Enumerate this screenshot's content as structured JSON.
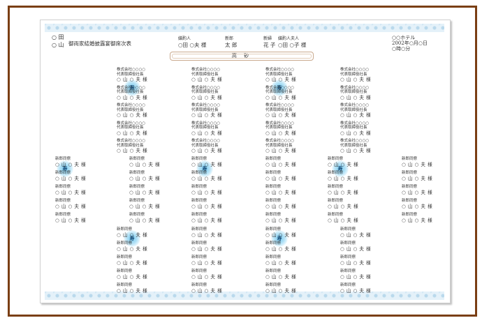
{
  "header": {
    "left_lines": [
      "○ 田",
      "○ 山"
    ],
    "title": "御両家結婚披露宴御席次表",
    "columns": [
      {
        "label": "媒酌人",
        "value": "○田 ○夫 様"
      },
      {
        "label": "新郎",
        "value": "太 郎"
      },
      {
        "label": "新婦",
        "value": "花 子"
      },
      {
        "label": "媒酌人夫人",
        "value": "○田 ○子 様"
      }
    ],
    "hotel": "○○ホテル",
    "date": "2002年○月○日",
    "time": "○時○分"
  },
  "head_table_label": "高 砂",
  "table_label": "寿",
  "guests": {
    "company_line1": "株式会社○○○○",
    "company_line2": "代表取締役社長",
    "colleague_line1": "新郎同僚",
    "name": "○ 山 ○ 夫 様"
  }
}
